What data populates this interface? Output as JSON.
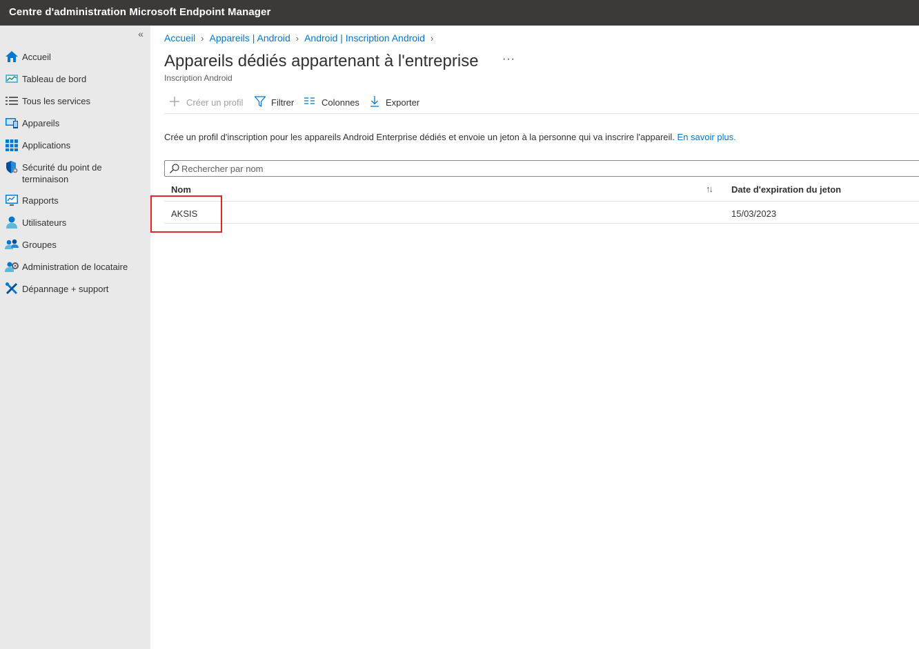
{
  "header": {
    "title": "Centre d'administration Microsoft Endpoint Manager"
  },
  "sidebar": {
    "collapse_label": "«",
    "items": [
      {
        "label": "Accueil",
        "icon": "home-icon"
      },
      {
        "label": "Tableau de bord",
        "icon": "dashboard-icon"
      },
      {
        "label": "Tous les services",
        "icon": "list-icon"
      },
      {
        "label": "Appareils",
        "icon": "devices-icon"
      },
      {
        "label": "Applications",
        "icon": "apps-grid-icon"
      },
      {
        "label": "Sécurité du point de terminaison",
        "icon": "shield-icon"
      },
      {
        "label": "Rapports",
        "icon": "reports-icon"
      },
      {
        "label": "Utilisateurs",
        "icon": "user-icon"
      },
      {
        "label": "Groupes",
        "icon": "groups-icon"
      },
      {
        "label": "Administration de locataire",
        "icon": "tenant-admin-icon"
      },
      {
        "label": "Dépannage + support",
        "icon": "troubleshoot-icon"
      }
    ]
  },
  "breadcrumb": [
    "Accueil",
    "Appareils | Android",
    "Android | Inscription Android"
  ],
  "page": {
    "title": "Appareils dédiés appartenant à l'entreprise",
    "subtitle": "Inscription Android",
    "more": "···"
  },
  "toolbar": {
    "create": "Créer un profil",
    "filter": "Filtrer",
    "columns": "Colonnes",
    "export": "Exporter"
  },
  "description": {
    "text": "Crée un profil d'inscription pour les appareils Android Enterprise dédiés et envoie un jeton à la personne qui va inscrire l'appareil.",
    "link": "En savoir plus."
  },
  "search": {
    "placeholder": "Rechercher par nom"
  },
  "table": {
    "columns": [
      "Nom",
      "Date d'expiration du jeton"
    ],
    "sort_indicator": "↑↓",
    "rows": [
      {
        "name": "AKSIS",
        "expiry": "15/03/2023"
      }
    ]
  },
  "colors": {
    "accent": "#0078d4",
    "topbar": "#3b3a39",
    "sidebar": "#e9e9e9",
    "highlight": "#e3242b"
  }
}
